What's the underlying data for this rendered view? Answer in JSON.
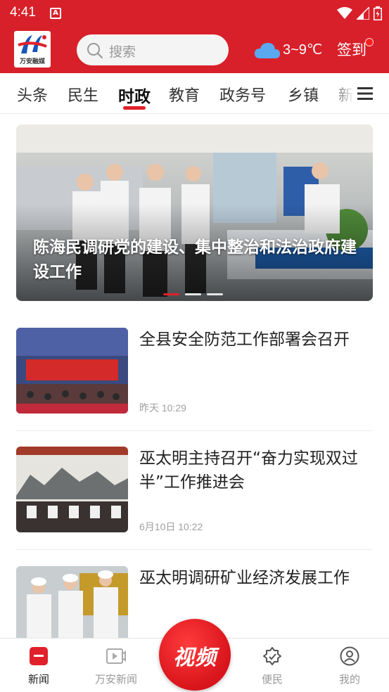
{
  "status_bar": {
    "time": "4:41",
    "notification_letter": "A"
  },
  "header": {
    "logo_text": "万安融媒",
    "search_placeholder": "搜索",
    "weather_icon": "cloud-icon",
    "temperature": "3~9℃",
    "signin_label": "签到"
  },
  "tabs": [
    {
      "label": "头条"
    },
    {
      "label": "民生"
    },
    {
      "label": "时政",
      "active": true
    },
    {
      "label": "教育"
    },
    {
      "label": "政务号"
    },
    {
      "label": "乡镇"
    },
    {
      "label": "新"
    }
  ],
  "banner": {
    "title": "陈海民调研党的建设、集中整治和法治政府建设工作",
    "slides_total": 3,
    "active_slide": 1
  },
  "news": [
    {
      "title": "全县安全防范工作部署会召开",
      "time": "昨天 10:29"
    },
    {
      "title": "巫太明主持召开“奋力实现双过半”工作推进会",
      "time": "6月10日 10:22"
    },
    {
      "title": "巫太明调研矿业经济发展工作",
      "time": ""
    }
  ],
  "bottom_nav": {
    "items": [
      {
        "label": "新闻",
        "icon": "news-icon",
        "active": true
      },
      {
        "label": "万安新闻",
        "icon": "video-play-icon"
      },
      {
        "label": "便民",
        "icon": "service-badge-icon"
      },
      {
        "label": "我的",
        "icon": "profile-icon"
      }
    ],
    "center_button": {
      "label": "视频"
    }
  },
  "colors": {
    "brand_red": "#d8202a",
    "active_red": "#e0202a",
    "meta_gray": "#a0a0a0"
  }
}
